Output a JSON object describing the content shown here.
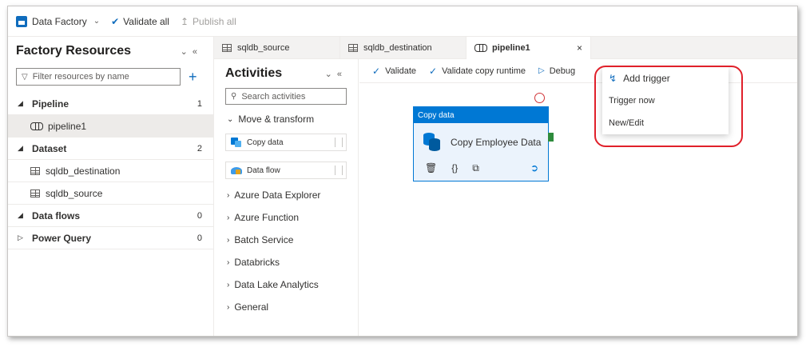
{
  "toolbar": {
    "factory_label": "Data Factory",
    "validate_all": "Validate all",
    "publish_all": "Publish all"
  },
  "resources": {
    "title": "Factory Resources",
    "filter_placeholder": "Filter resources by name",
    "groups": [
      {
        "label": "Pipeline",
        "count": "1"
      },
      {
        "label": "Dataset",
        "count": "2"
      },
      {
        "label": "Data flows",
        "count": "0"
      },
      {
        "label": "Power Query",
        "count": "0"
      }
    ],
    "pipeline_items": [
      "pipeline1"
    ],
    "dataset_items": [
      "sqldb_destination",
      "sqldb_source"
    ]
  },
  "tabs": [
    {
      "label": "sqldb_source"
    },
    {
      "label": "sqldb_destination"
    },
    {
      "label": "pipeline1",
      "close": "×"
    }
  ],
  "activities": {
    "title": "Activities",
    "search_placeholder": "Search activities",
    "expanded_category": "Move & transform",
    "items": [
      "Copy data",
      "Data flow"
    ],
    "categories": [
      "Azure Data Explorer",
      "Azure Function",
      "Batch Service",
      "Databricks",
      "Data Lake Analytics",
      "General"
    ]
  },
  "canvas": {
    "validate": "Validate",
    "validate_copy_runtime": "Validate copy runtime",
    "debug": "Debug",
    "node": {
      "type_label": "Copy data",
      "name": "Copy Employee Data"
    }
  },
  "trigger_menu": {
    "header": "Add trigger",
    "items": [
      "Trigger now",
      "New/Edit"
    ]
  },
  "colors": {
    "accent": "#0078d4",
    "highlight": "#e0202a"
  }
}
